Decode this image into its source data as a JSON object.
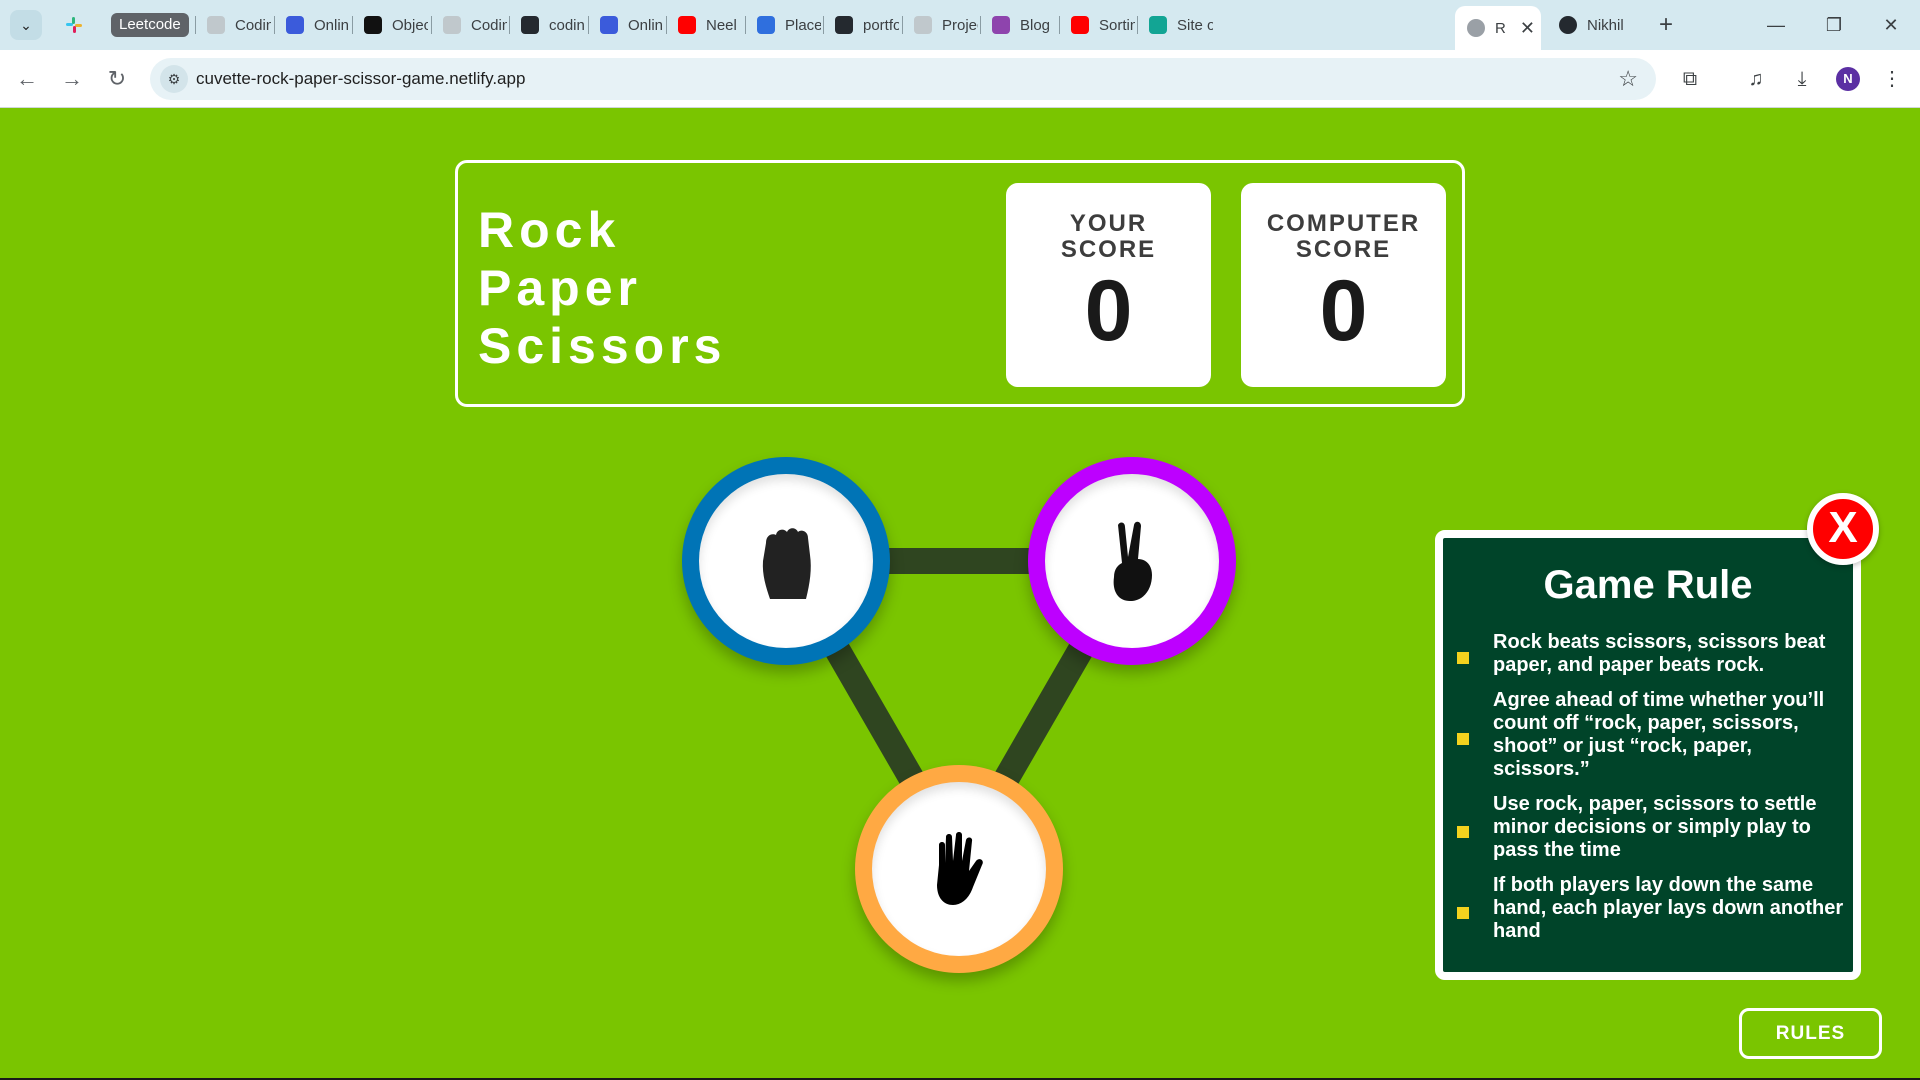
{
  "browser": {
    "tab_group_label": "Leetcode",
    "tabs": [
      {
        "label": "Codin",
        "color": "#c0c8cc"
      },
      {
        "label": "Onlin",
        "color": "#3b5bdb"
      },
      {
        "label": "Objec",
        "color": "#111111"
      },
      {
        "label": "Codin",
        "color": "#c0c8cc"
      },
      {
        "label": "codin",
        "color": "#24292f"
      },
      {
        "label": "Onlin",
        "color": "#3b5bdb"
      },
      {
        "label": "Neel",
        "color": "#ff0000"
      },
      {
        "label": "Placer",
        "color": "#2f6fde"
      },
      {
        "label": "portfo",
        "color": "#24292f"
      },
      {
        "label": "Projec",
        "color": "#c0c8cc"
      },
      {
        "label": "Blog",
        "color": "#8e44ad"
      },
      {
        "label": "Sortin",
        "color": "#ff0000"
      },
      {
        "label": "Site o",
        "color": "#12a594"
      }
    ],
    "active_tab": {
      "label": "R"
    },
    "last_tab": {
      "label": "Nikhil",
      "color": "#24292f"
    },
    "url": "cuvette-rock-paper-scissor-game.netlify.app",
    "profile_initial": "N"
  },
  "game": {
    "title_lines": [
      "Rock",
      "Paper",
      "Scissors"
    ],
    "your_score": {
      "label_line1": "YOUR",
      "label_line2": "SCORE",
      "value": "0"
    },
    "computer_score": {
      "label_line1": "COMPUTER",
      "label_line2": "SCORE",
      "value": "0"
    },
    "choices": [
      {
        "name": "rock",
        "ring_color": "#0074b6",
        "icon": "rock-fist-icon"
      },
      {
        "name": "scissors",
        "ring_color": "#bd00ff",
        "icon": "scissors-hand-icon"
      },
      {
        "name": "paper",
        "ring_color": "#ffa943",
        "icon": "paper-hand-icon"
      }
    ]
  },
  "rules_panel": {
    "title": "Game Rule",
    "close_label": "X",
    "rules": [
      "Rock beats scissors, scissors beat paper, and paper beats rock.",
      "Agree ahead of time whether you’ll count off “rock, paper, scissors, shoot” or just “rock, paper, scissors.”",
      "Use rock, paper, scissors to settle minor decisions or simply play to pass the time",
      "If both players lay down the same hand, each player lays down another hand"
    ]
  },
  "rules_button_label": "RULES",
  "colors": {
    "background": "#7ac500",
    "rules_panel_bg": "#004429",
    "bullet": "#f4d21e",
    "close_button": "#ff0000"
  }
}
